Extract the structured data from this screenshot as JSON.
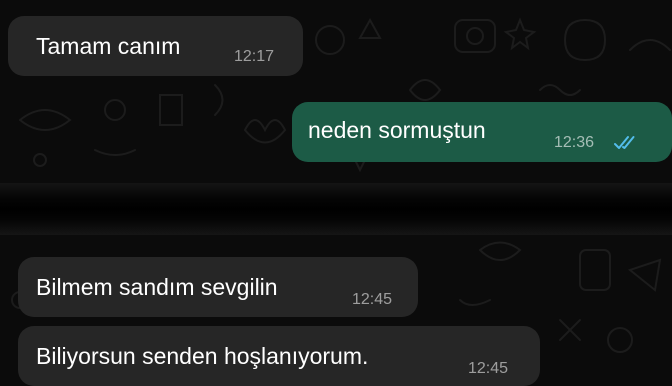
{
  "chat": {
    "messages": [
      {
        "direction": "incoming",
        "text": "Tamam canım",
        "time": "12:17"
      },
      {
        "direction": "outgoing",
        "text": "neden sormuştun",
        "time": "12:36",
        "status": "read"
      },
      {
        "direction": "incoming",
        "text": "Bilmem sandım sevgilin",
        "time": "12:45"
      },
      {
        "direction": "incoming",
        "text": "Biliyorsun senden hoşlanıyorum.",
        "time": "12:45"
      }
    ]
  },
  "colors": {
    "background": "#0b0b0b",
    "incoming_bubble": "#262626",
    "outgoing_bubble": "#1c5b46",
    "read_ticks": "#53bdeb"
  },
  "icons": [
    "double-check-icon"
  ]
}
